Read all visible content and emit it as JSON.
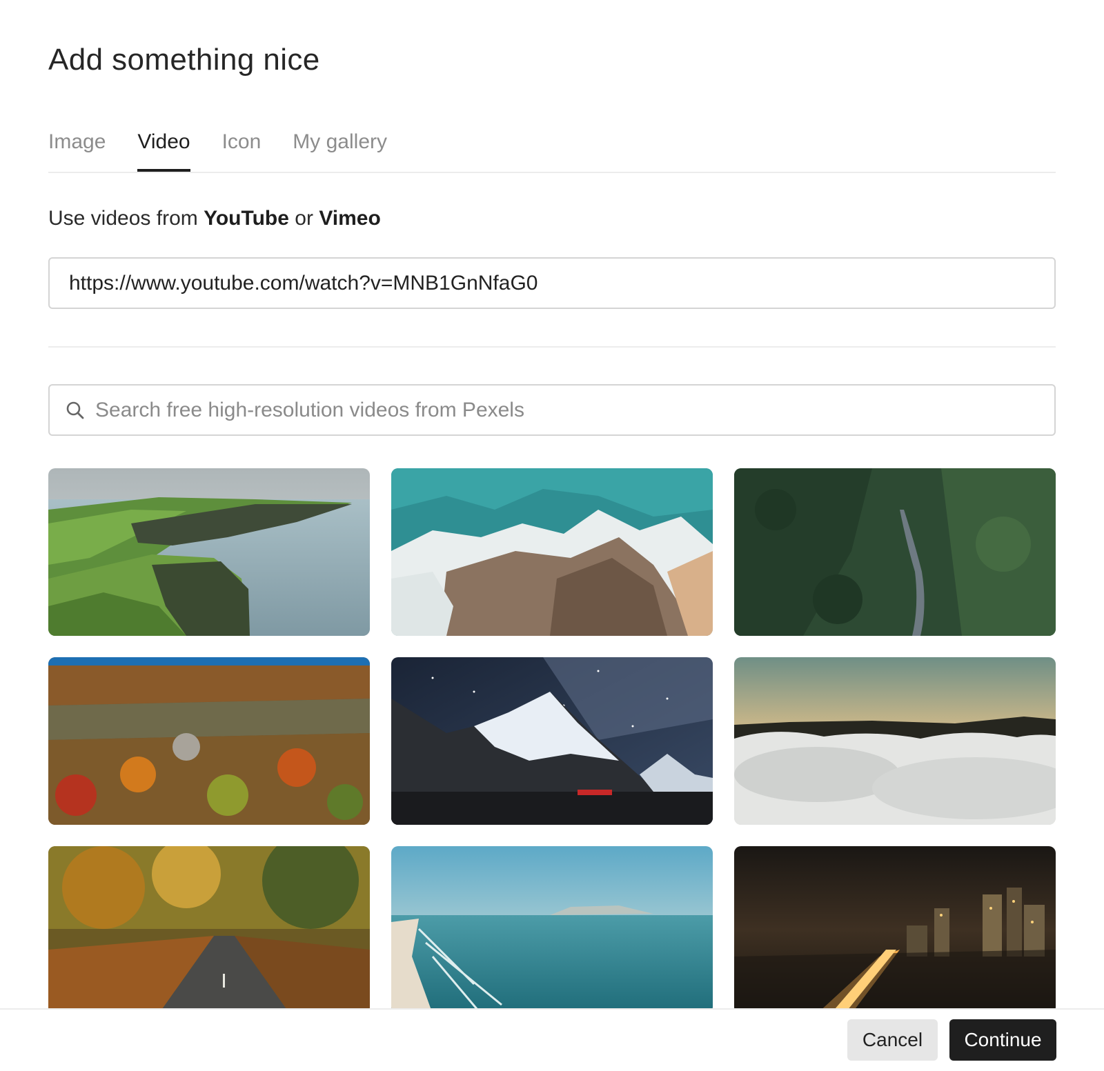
{
  "dialog": {
    "title": "Add something nice"
  },
  "tabs": [
    {
      "label": "Image",
      "active": false
    },
    {
      "label": "Video",
      "active": true
    },
    {
      "label": "Icon",
      "active": false
    },
    {
      "label": "My gallery",
      "active": false
    }
  ],
  "video_source": {
    "prefix": "Use videos from ",
    "service_1": "YouTube",
    "connector": " or ",
    "service_2": "Vimeo",
    "url_value": "https://www.youtube.com/watch?v=MNB1GnNfaG0"
  },
  "search": {
    "icon": "search-icon",
    "placeholder": "Search free high-resolution videos from Pexels"
  },
  "thumbnails": [
    {
      "scene": "coastal-cliffs",
      "icon": "video-thumbnail"
    },
    {
      "scene": "aerial-ocean-waves-rocks",
      "icon": "video-thumbnail"
    },
    {
      "scene": "forest-road-aerial",
      "icon": "video-thumbnail"
    },
    {
      "scene": "autumn-forest-canyon",
      "icon": "video-thumbnail"
    },
    {
      "scene": "starry-night-mountain",
      "icon": "video-thumbnail"
    },
    {
      "scene": "sunrise-above-clouds",
      "icon": "video-thumbnail"
    },
    {
      "scene": "autumn-forest-road",
      "icon": "video-thumbnail"
    },
    {
      "scene": "ocean-beach-coast",
      "icon": "video-thumbnail"
    },
    {
      "scene": "city-night-traffic",
      "icon": "video-thumbnail"
    }
  ],
  "footer": {
    "cancel_label": "Cancel",
    "continue_label": "Continue"
  },
  "colors": {
    "primary_button": "#1f1f1f",
    "secondary_button": "#e6e6e6",
    "active_tab": "#1e1e1e",
    "inactive_tab": "#8c8c8c"
  }
}
